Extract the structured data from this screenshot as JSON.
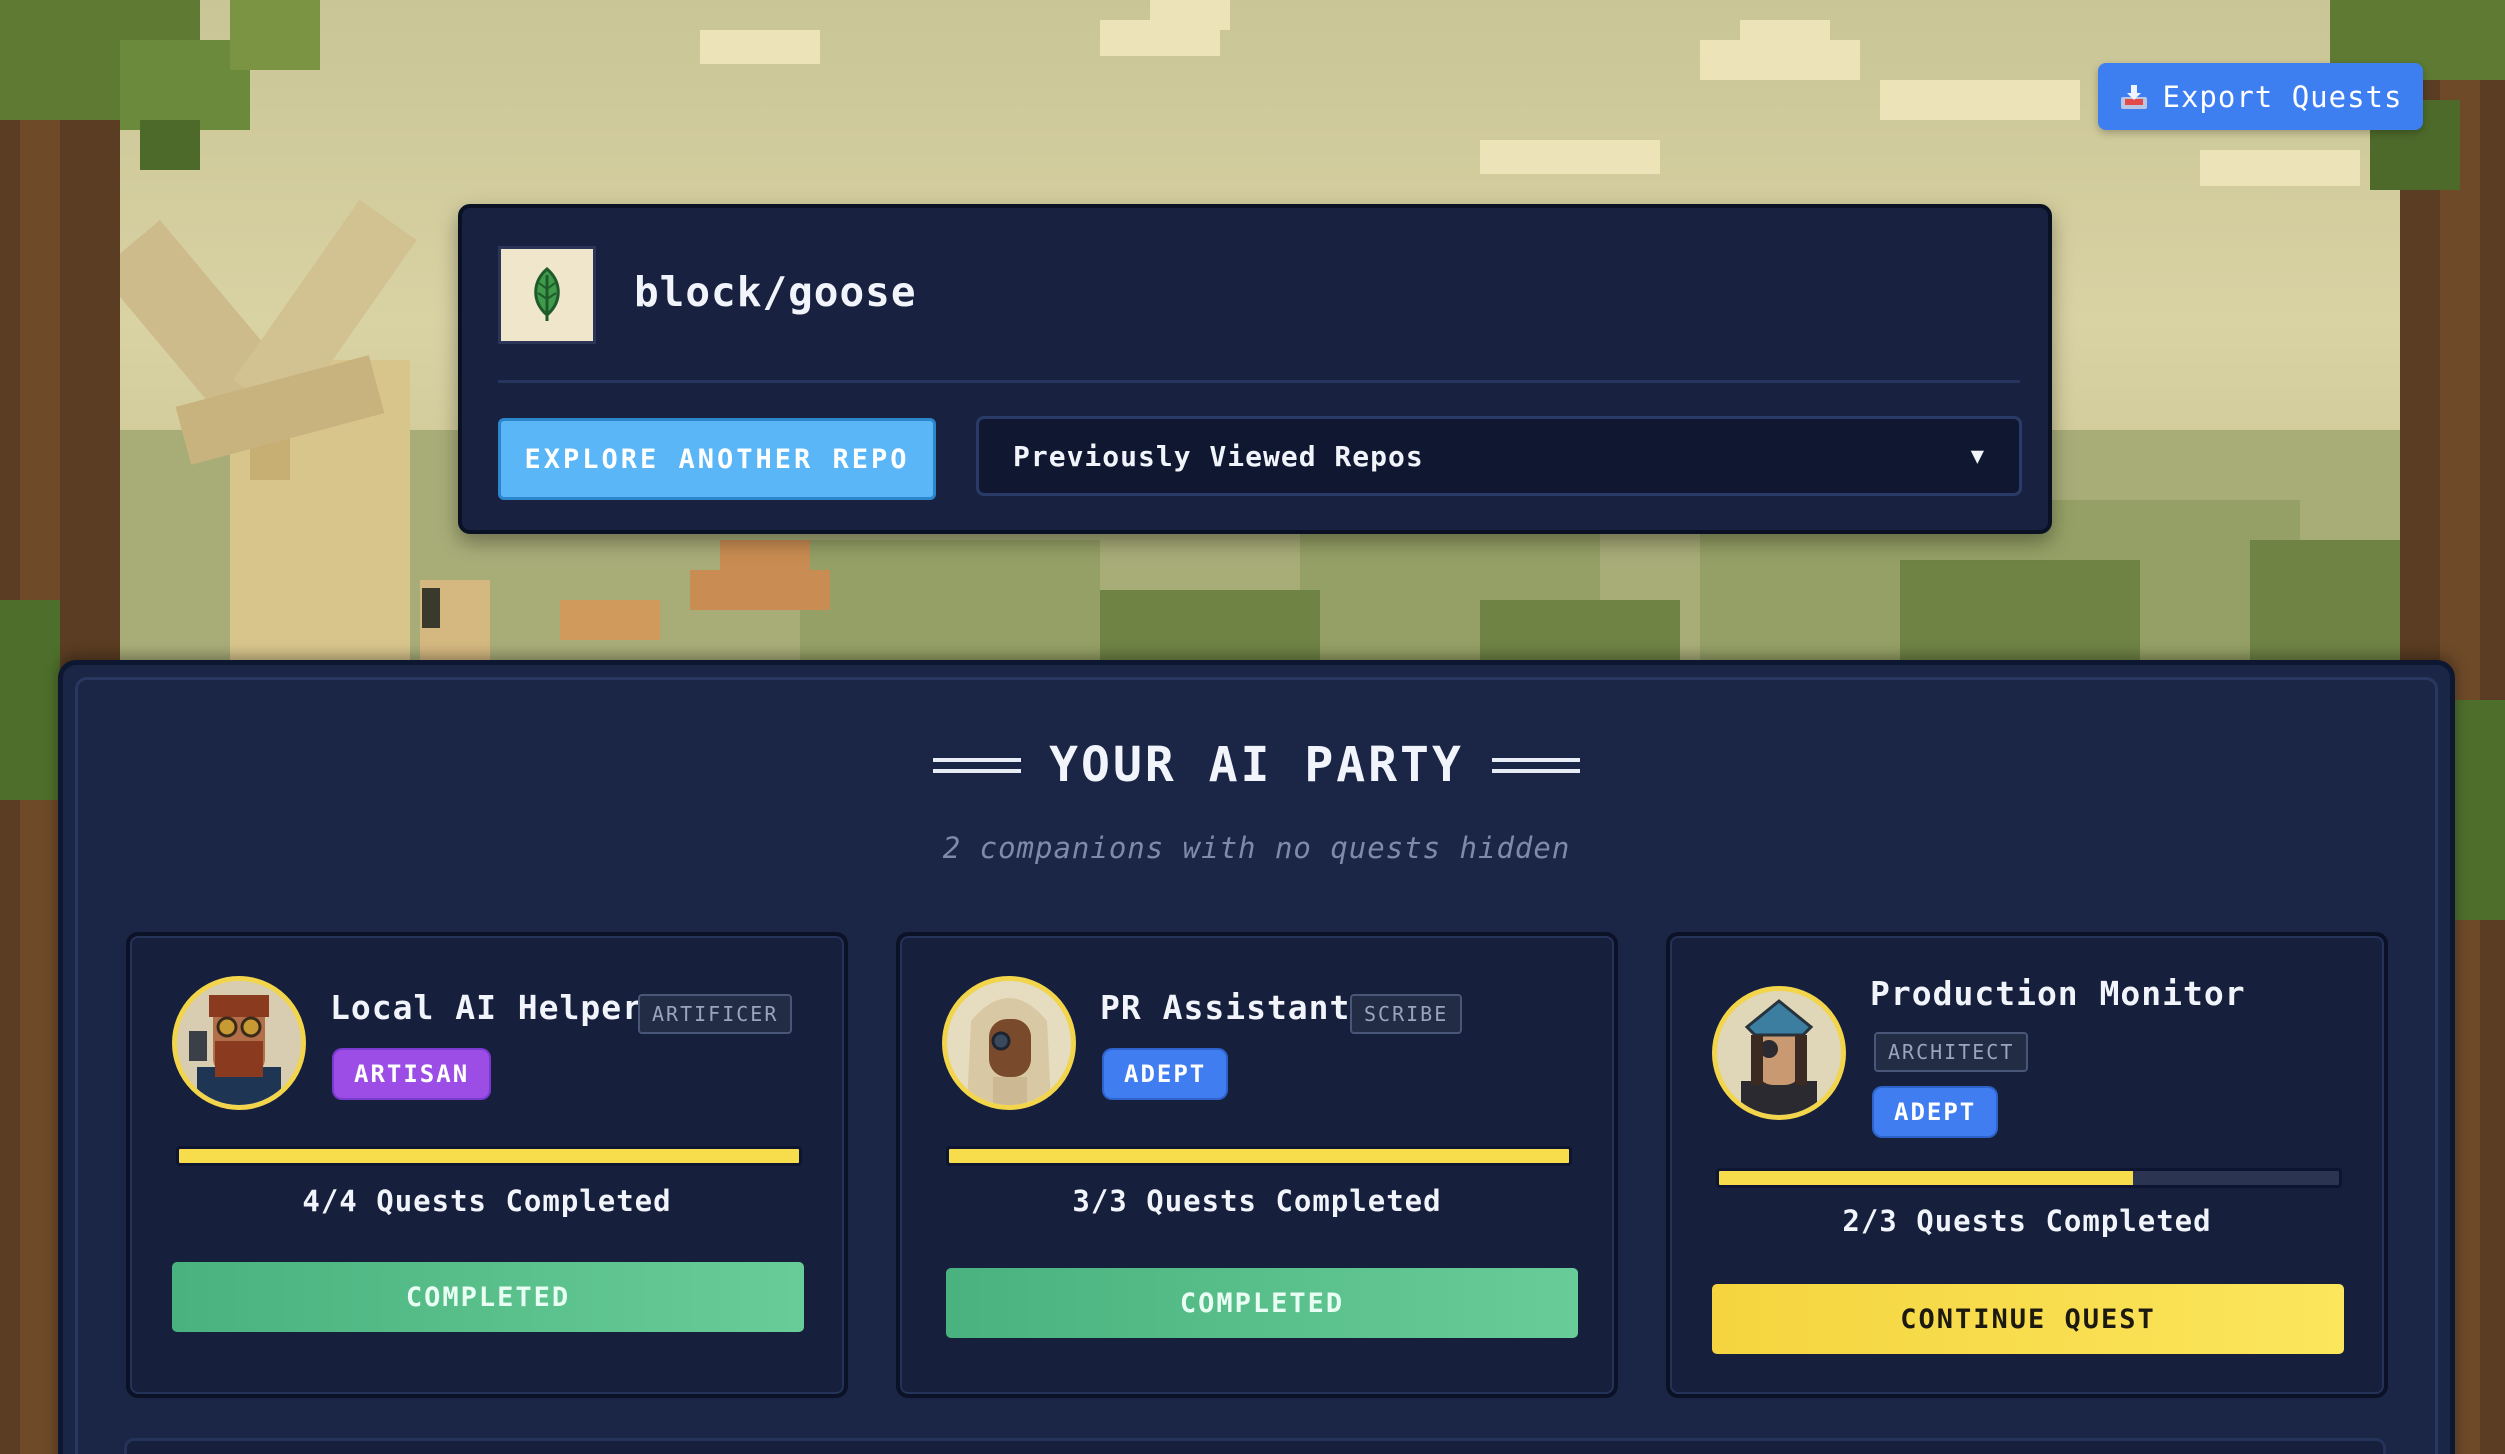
{
  "header": {
    "export_label": "Export Quests",
    "export_icon": "inbox-tray-icon"
  },
  "repo": {
    "name": "block/goose",
    "icon": "leaf-icon",
    "explore_label": "EXPLORE ANOTHER REPO",
    "previous_label": "Previously Viewed Repos",
    "previous_caret": "▼"
  },
  "party": {
    "title": "YOUR AI PARTY",
    "subtitle": "2 companions with no quests hidden",
    "companions": [
      {
        "name": "Local AI Helper",
        "class": "ARTIFICER",
        "rank": "ARTISAN",
        "progress_fraction": 1.0,
        "progress_text": "4/4 Quests Completed",
        "action": "COMPLETED"
      },
      {
        "name": "PR Assistant",
        "class": "SCRIBE",
        "rank": "ADEPT",
        "progress_fraction": 1.0,
        "progress_text": "3/3 Quests Completed",
        "action": "COMPLETED"
      },
      {
        "name": "Production Monitor",
        "class": "ARCHITECT",
        "rank": "ADEPT",
        "progress_fraction": 0.667,
        "progress_text": "2/3 Quests Completed",
        "action": "CONTINUE QUEST"
      }
    ]
  },
  "colors": {
    "accent_blue": "#3d7ff0",
    "panel": "#1b2646",
    "progress_yellow": "#f7dc4c",
    "completed_green": "#5bbf8a",
    "continue_yellow": "#f8dd4d",
    "rank_artisan": "#9b4de6",
    "rank_adept": "#3f7df0"
  }
}
